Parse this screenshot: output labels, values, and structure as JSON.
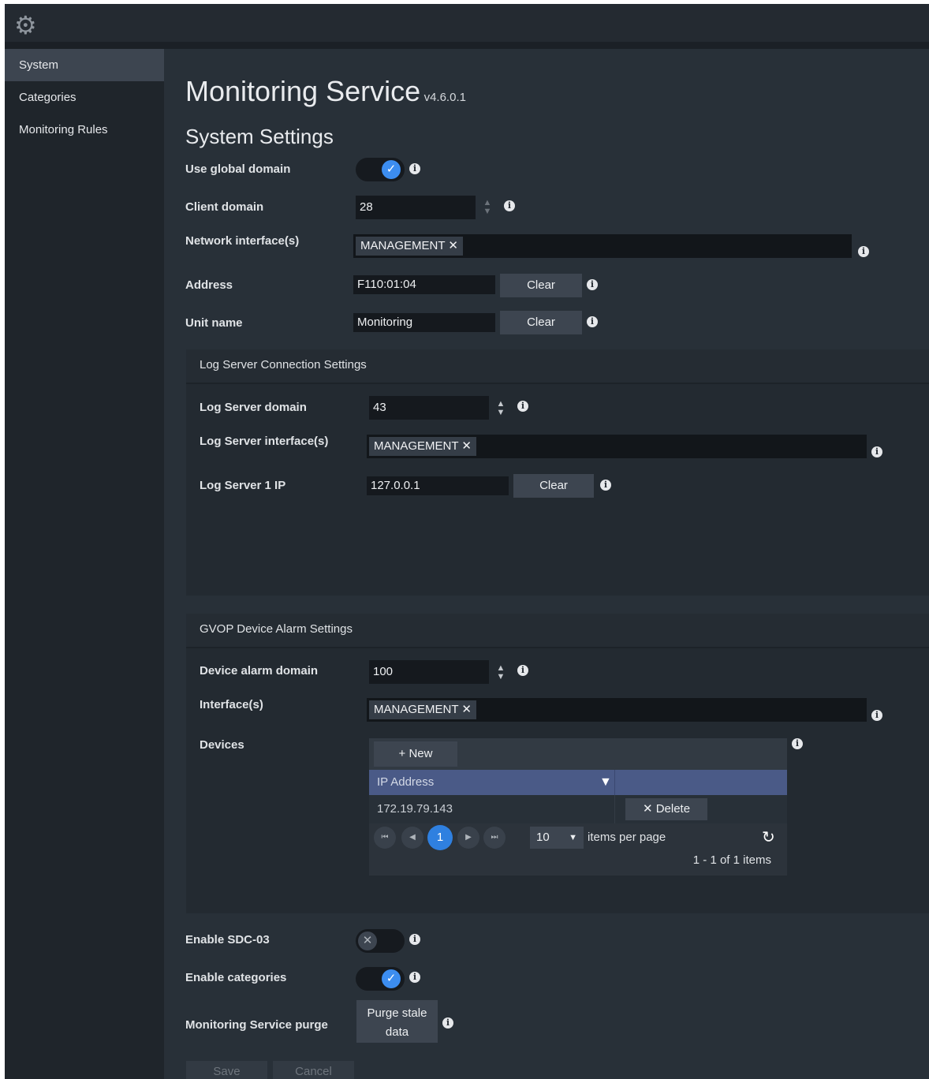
{
  "app": {
    "settings_icon": "gear-icon"
  },
  "sidebar": {
    "items": [
      {
        "label": "System",
        "active": true
      },
      {
        "label": "Categories",
        "active": false
      },
      {
        "label": "Monitoring Rules",
        "active": false
      }
    ]
  },
  "page": {
    "title": "Monitoring Service",
    "version": "v4.6.0.1",
    "section_title": "System Settings"
  },
  "system": {
    "use_global_domain": {
      "label": "Use global domain",
      "value": true
    },
    "client_domain": {
      "label": "Client domain",
      "value": "28"
    },
    "network_interfaces": {
      "label": "Network interface(s)",
      "tags": [
        "MANAGEMENT"
      ]
    },
    "address": {
      "label": "Address",
      "value": "F110:01:04",
      "clear_label": "Clear"
    },
    "unit_name": {
      "label": "Unit name",
      "value": "Monitoring",
      "clear_label": "Clear"
    }
  },
  "log_server": {
    "title": "Log Server Connection Settings",
    "domain": {
      "label": "Log Server domain",
      "value": "43"
    },
    "interfaces": {
      "label": "Log Server interface(s)",
      "tags": [
        "MANAGEMENT"
      ]
    },
    "ip": {
      "label": "Log Server 1 IP",
      "value": "127.0.0.1",
      "clear_label": "Clear"
    }
  },
  "gvop": {
    "title": "GVOP Device Alarm Settings",
    "domain": {
      "label": "Device alarm domain",
      "value": "100"
    },
    "interfaces": {
      "label": "Interface(s)",
      "tags": [
        "MANAGEMENT"
      ]
    },
    "devices": {
      "label": "Devices",
      "new_label": "New",
      "column": "IP Address",
      "rows": [
        {
          "ip": "172.19.79.143",
          "delete_label": "Delete"
        }
      ],
      "current_page": "1",
      "page_size": "10",
      "per_page_label": "items per page",
      "summary": "1 - 1 of 1 items"
    }
  },
  "extra": {
    "enable_sdc": {
      "label": "Enable SDC-03",
      "value": false
    },
    "enable_categories": {
      "label": "Enable categories",
      "value": true
    },
    "purge": {
      "label": "Monitoring Service purge",
      "button_line1": "Purge stale",
      "button_line2": "data"
    }
  },
  "footer": {
    "save_label": "Save",
    "cancel_label": "Cancel"
  },
  "colors": {
    "accent": "#3c8df0",
    "grid_header": "#4a5a87",
    "background": "#283038"
  }
}
